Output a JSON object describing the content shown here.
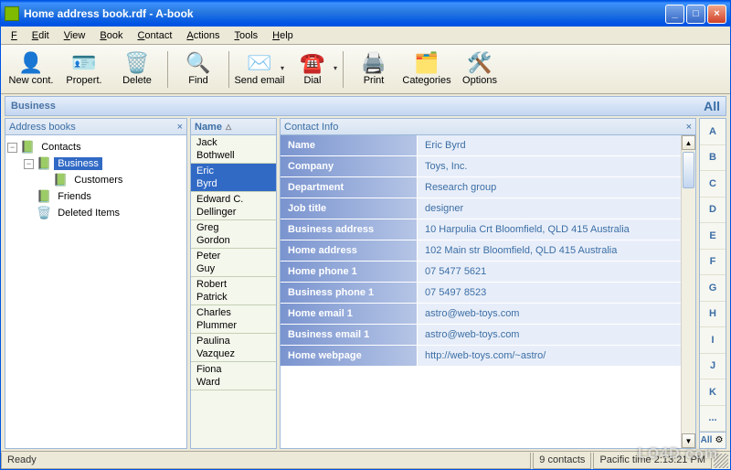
{
  "window": {
    "title": "Home address book.rdf - A-book"
  },
  "menu": [
    "File",
    "Edit",
    "View",
    "Book",
    "Contact",
    "Actions",
    "Tools",
    "Help"
  ],
  "toolbar": {
    "new": "New cont.",
    "properties": "Propert.",
    "delete": "Delete",
    "find": "Find",
    "send_email": "Send email",
    "dial": "Dial",
    "print": "Print",
    "categories": "Categories",
    "options": "Options"
  },
  "crumb": {
    "label": "Business",
    "filter": "All"
  },
  "treepanel": {
    "title": "Address books"
  },
  "tree": {
    "root": "Contacts",
    "business": "Business",
    "customers": "Customers",
    "friends": "Friends",
    "deleted": "Deleted Items"
  },
  "namehdr": "Name",
  "names": [
    "Jack Bothwell",
    "Eric Byrd",
    "Edward C. Dellinger",
    "Greg Gordon",
    "Peter Guy",
    "Robert Patrick",
    "Charles Plummer",
    "Paulina Vazquez",
    "Fiona Ward"
  ],
  "names_selected_index": 1,
  "infohdr": "Contact Info",
  "info": [
    {
      "k": "Name",
      "v": "Eric Byrd"
    },
    {
      "k": "Company",
      "v": "Toys, Inc."
    },
    {
      "k": "Department",
      "v": "Research group"
    },
    {
      "k": "Job title",
      "v": "designer"
    },
    {
      "k": "Business address",
      "v": "10 Harpulia Crt Bloomfield, QLD 415 Australia"
    },
    {
      "k": "Home address",
      "v": "102 Main str Bloomfield, QLD 415 Australia"
    },
    {
      "k": "Home phone 1",
      "v": "07 5477 5621"
    },
    {
      "k": "Business phone 1",
      "v": "07 5497 8523"
    },
    {
      "k": "Home email 1",
      "v": "astro@web-toys.com"
    },
    {
      "k": "Business email 1",
      "v": "astro@web-toys.com"
    },
    {
      "k": "Home webpage",
      "v": "http://web-toys.com/~astro/"
    }
  ],
  "alpha": [
    "A",
    "B",
    "C",
    "D",
    "E",
    "F",
    "G",
    "H",
    "I",
    "J",
    "K",
    "..."
  ],
  "alpha_all": "All",
  "status": {
    "ready": "Ready",
    "count": "9 contacts",
    "time": "Pacific time 2:13:21 PM"
  },
  "watermark": "LO4D.com"
}
